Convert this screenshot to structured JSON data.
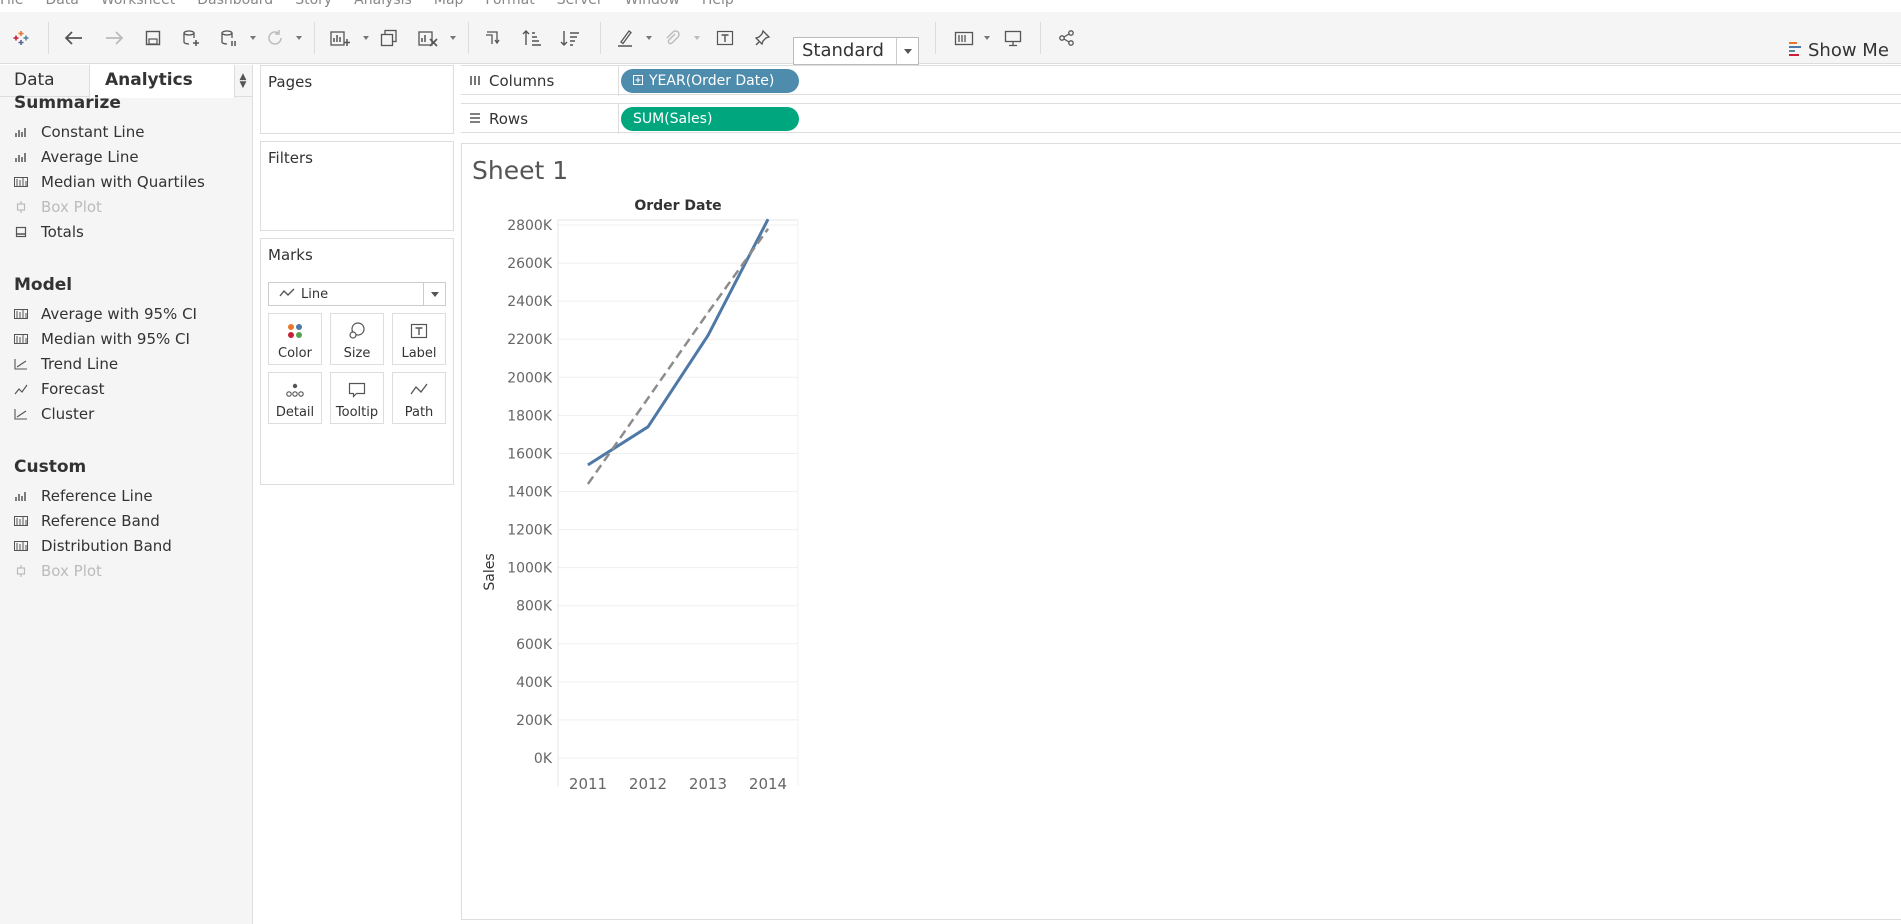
{
  "menu": [
    "File",
    "Data",
    "Worksheet",
    "Dashboard",
    "Story",
    "Analysis",
    "Map",
    "Format",
    "Server",
    "Window",
    "Help"
  ],
  "toolbar": {
    "fit_select": "Standard",
    "show_me": "Show Me",
    "icons": [
      "tableau-logo-icon",
      "undo-icon",
      "redo-icon",
      "save-icon",
      "new-data-source-icon",
      "pause-updates-icon",
      "refresh-icon",
      "new-worksheet-icon",
      "duplicate-sheet-icon",
      "clear-sheet-icon",
      "swap-icon",
      "sort-ascending-icon",
      "sort-descending-icon",
      "highlight-icon",
      "group-icon",
      "show-labels-icon",
      "fix-axes-icon",
      "show-cards-icon",
      "presentation-icon",
      "share-icon"
    ]
  },
  "left_pane": {
    "tabs": {
      "data": "Data",
      "analytics": "Analytics"
    },
    "sections": [
      {
        "title": "Summarize",
        "items": [
          {
            "label": "Constant Line",
            "disabled": false
          },
          {
            "label": "Average Line",
            "disabled": false
          },
          {
            "label": "Median with Quartiles",
            "disabled": false
          },
          {
            "label": "Box Plot",
            "disabled": true
          },
          {
            "label": "Totals",
            "disabled": false
          }
        ]
      },
      {
        "title": "Model",
        "items": [
          {
            "label": "Average with 95% CI",
            "disabled": false
          },
          {
            "label": "Median with 95% CI",
            "disabled": false
          },
          {
            "label": "Trend Line",
            "disabled": false
          },
          {
            "label": "Forecast",
            "disabled": false
          },
          {
            "label": "Cluster",
            "disabled": false
          }
        ]
      },
      {
        "title": "Custom",
        "items": [
          {
            "label": "Reference Line",
            "disabled": false
          },
          {
            "label": "Reference Band",
            "disabled": false
          },
          {
            "label": "Distribution Band",
            "disabled": false
          },
          {
            "label": "Box Plot",
            "disabled": true
          }
        ]
      }
    ]
  },
  "cards": {
    "pages": "Pages",
    "filters": "Filters",
    "marks": "Marks",
    "mark_type": "Line",
    "mark_buttons": [
      "Color",
      "Size",
      "Label",
      "Detail",
      "Tooltip",
      "Path"
    ]
  },
  "shelves": {
    "columns_label": "Columns",
    "columns_pill": "YEAR(Order Date)",
    "rows_label": "Rows",
    "rows_pill": "SUM(Sales)",
    "columns_pill_color": "#4e8cad",
    "rows_pill_color": "#00a77e"
  },
  "sheet": {
    "title": "Sheet 1"
  },
  "chart_data": {
    "type": "line",
    "title": "",
    "column_header": "Order Date",
    "xlabel": "",
    "ylabel": "Sales",
    "categories": [
      "2011",
      "2012",
      "2013",
      "2014"
    ],
    "series": [
      {
        "values": [
          1540000,
          1740000,
          2220000,
          2830000
        ],
        "color": "#4e79a7",
        "dash": false
      },
      {
        "values": [
          1440000,
          1890000,
          2340000,
          2780000
        ],
        "color": "#8c8c8c",
        "dash": true
      }
    ],
    "ylim": [
      0,
      2900000
    ],
    "yticks": [
      0,
      200000,
      400000,
      600000,
      800000,
      1000000,
      1200000,
      1400000,
      1600000,
      1800000,
      2000000,
      2200000,
      2400000,
      2600000,
      2800000
    ],
    "ytick_labels": [
      "0K",
      "200K",
      "400K",
      "600K",
      "800K",
      "1000K",
      "1200K",
      "1400K",
      "1600K",
      "1800K",
      "2000K",
      "2200K",
      "2400K",
      "2600K",
      "2800K"
    ],
    "grid": true
  }
}
